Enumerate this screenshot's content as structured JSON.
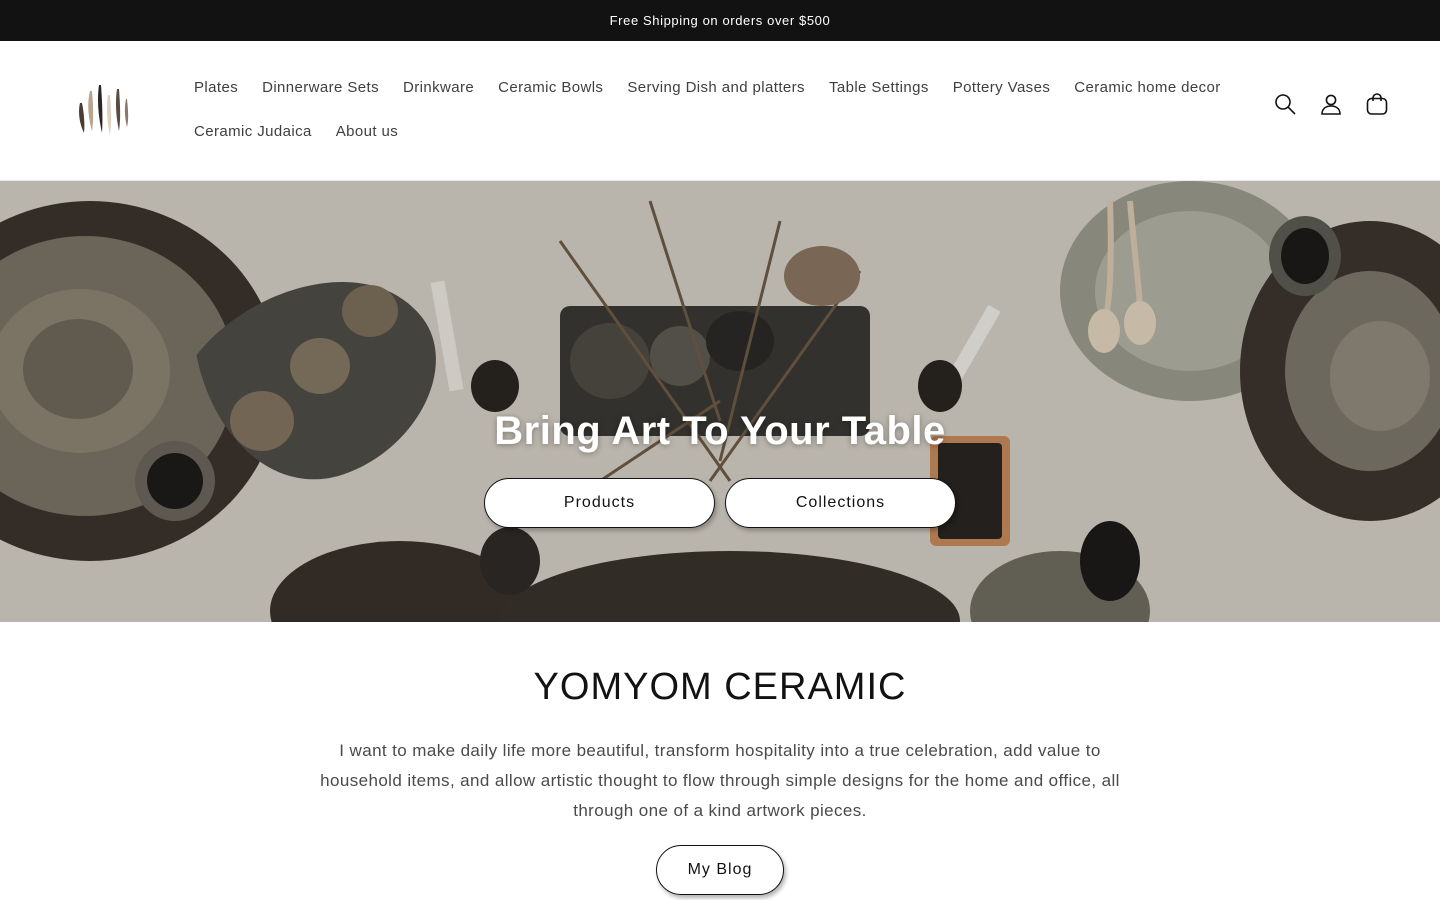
{
  "announcement": {
    "text": "Free Shipping on orders over $500"
  },
  "header": {
    "logo_icon": "brand-brushstroke-logo",
    "nav_row1": [
      {
        "label": "Plates"
      },
      {
        "label": "Dinnerware Sets"
      },
      {
        "label": "Drinkware"
      },
      {
        "label": "Ceramic Bowls"
      },
      {
        "label": "Serving Dish and platters"
      },
      {
        "label": "Table Settings"
      },
      {
        "label": "Pottery Vases"
      },
      {
        "label": "Ceramic home decor"
      }
    ],
    "nav_row2": [
      {
        "label": "Ceramic Judaica"
      },
      {
        "label": "About us"
      }
    ],
    "icons": [
      "search-icon",
      "account-icon",
      "cart-icon"
    ]
  },
  "hero": {
    "title": "Bring Art To Your Table",
    "buttons": [
      {
        "label": "Products"
      },
      {
        "label": "Collections"
      }
    ]
  },
  "about": {
    "title": "YOMYOM CERAMIC",
    "text": "I want to make daily life more beautiful, transform hospitality into a true celebration, add value to household items, and allow artistic thought to flow through simple designs for the home and office, all through one of a kind artwork pieces.",
    "blog_button": "My Blog"
  },
  "colors": {
    "announcement_bg": "#121212",
    "text": "#121212",
    "nav_text": "#3f3f3f",
    "hero_bg": "#d9d5cc"
  }
}
